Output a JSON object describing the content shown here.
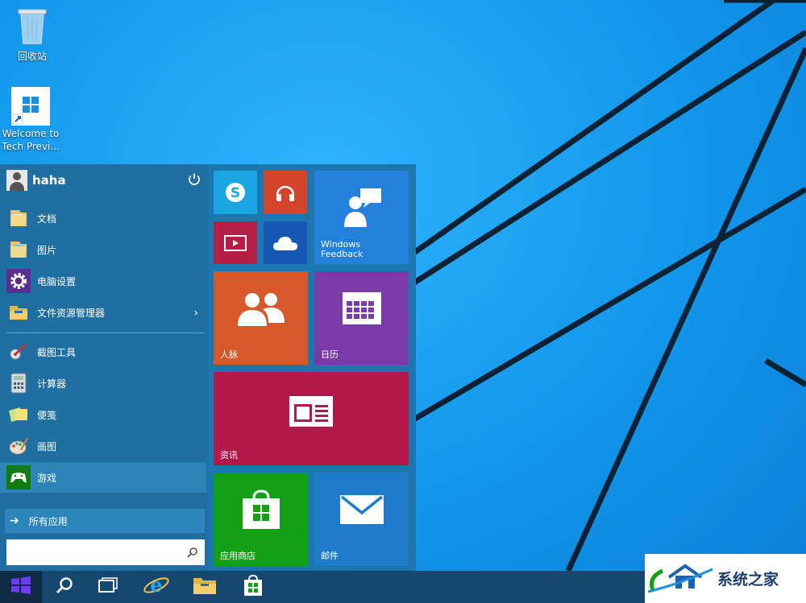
{
  "desktop": {
    "icons": [
      {
        "label": "回收站",
        "icon": "recycle-bin-icon"
      },
      {
        "label": "Welcome to Tech Previ...",
        "line1": "Welcome to",
        "line2": "Tech Previ...",
        "icon": "windows-logo-icon"
      }
    ]
  },
  "start_menu": {
    "user": {
      "name": "haha",
      "power_icon": "power-icon"
    },
    "places": [
      {
        "label": "文档",
        "icon": "documents-folder-icon"
      },
      {
        "label": "图片",
        "icon": "pictures-folder-icon"
      },
      {
        "label": "电脑设置",
        "icon": "gear-icon"
      },
      {
        "label": "文件资源管理器",
        "icon": "file-explorer-icon",
        "has_submenu": true
      }
    ],
    "apps": [
      {
        "label": "截图工具",
        "icon": "snipping-tool-icon"
      },
      {
        "label": "计算器",
        "icon": "calculator-icon"
      },
      {
        "label": "便笺",
        "icon": "sticky-notes-icon"
      },
      {
        "label": "画图",
        "icon": "paint-palette-icon"
      },
      {
        "label": "游戏",
        "icon": "games-icon",
        "highlighted": true
      }
    ],
    "all_apps_label": "所有应用",
    "search": {
      "value": "",
      "placeholder": ""
    },
    "tiles": {
      "skype": {
        "label": "",
        "icon": "skype-icon",
        "color": "#1aa5e4"
      },
      "music": {
        "label": "",
        "icon": "headphones-icon",
        "color": "#d2452a"
      },
      "video": {
        "label": "",
        "icon": "video-icon",
        "color": "#b51e47"
      },
      "onedrive": {
        "label": "",
        "icon": "cloud-icon",
        "color": "#1558b4"
      },
      "feedback": {
        "label_line1": "Windows",
        "label_line2": "Feedback",
        "icon": "feedback-icon",
        "color": "#2480dd"
      },
      "people": {
        "label": "人脉",
        "icon": "people-icon",
        "color": "#d7582b"
      },
      "calendar": {
        "label": "日历",
        "icon": "calendar-icon",
        "color": "#7a3ba8"
      },
      "news": {
        "label": "资讯",
        "icon": "news-icon",
        "color": "#b3184a"
      },
      "store": {
        "label": "应用商店",
        "icon": "store-bag-icon",
        "color": "#12a114"
      },
      "mail": {
        "label": "邮件",
        "icon": "mail-icon",
        "color": "#1f7ccc"
      }
    }
  },
  "taskbar": {
    "buttons": [
      {
        "icon": "windows-start-icon"
      },
      {
        "icon": "search-icon"
      },
      {
        "icon": "task-view-icon"
      },
      {
        "icon": "internet-explorer-icon"
      },
      {
        "icon": "file-explorer-icon"
      },
      {
        "icon": "store-icon"
      }
    ]
  },
  "watermark": {
    "text": "系统之家"
  }
}
